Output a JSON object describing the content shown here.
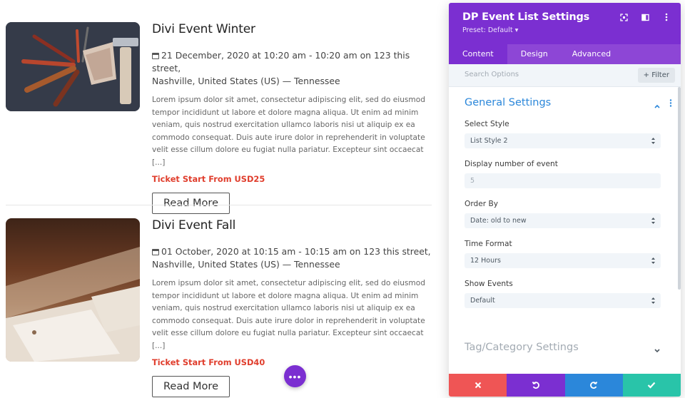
{
  "events": [
    {
      "title": "Divi Event Winter",
      "date_line": "21 December, 2020 at 10:20 am - 10:20 am on 123 this street,",
      "location_line": "Nashville, United States (US) — Tennessee",
      "description": "Lorem ipsum dolor sit amet, consectetur adipiscing elit, sed do eiusmod tempor incididunt ut labore et dolore magna aliqua. Ut enim ad minim veniam, quis nostrud exercitation ullamco laboris nisi ut aliquip ex ea commodo consequat. Duis aute irure dolor in reprehenderit in voluptate velit esse cillum dolore eu fugiat nulla pariatur. Excepteur sint occaecat [...]",
      "price": "Ticket Start From USD25",
      "button": "Read More"
    },
    {
      "title": "Divi Event Fall",
      "date_line": "01 October, 2020 at 10:15 am - 10:15 am on 123 this street,",
      "location_line": "Nashville, United States (US) — Tennessee",
      "description": "Lorem ipsum dolor sit amet, consectetur adipiscing elit, sed do eiusmod tempor incididunt ut labore et dolore magna aliqua. Ut enim ad minim veniam, quis nostrud exercitation ullamco laboris nisi ut aliquip ex ea commodo consequat. Duis aute irure dolor in reprehenderit in voluptate velit esse cillum dolore eu fugiat nulla pariatur. Excepteur sint occaecat [...]",
      "price": "Ticket Start From USD40",
      "button": "Read More"
    }
  ],
  "fab": {
    "label": "•••"
  },
  "panel": {
    "title": "DP Event List Settings",
    "preset": "Preset: Default ▾",
    "tabs": [
      "Content",
      "Design",
      "Advanced"
    ],
    "active_tab": "Content",
    "search_placeholder": "Search Options",
    "filter_label": "+ Filter",
    "section_title": "General Settings",
    "fields": [
      {
        "label": "Select Style",
        "value": "List Style 2"
      },
      {
        "label": "Display number of event",
        "value": "5"
      },
      {
        "label": "Order By",
        "value": "Date: old to new"
      },
      {
        "label": "Time Format",
        "value": "12 Hours"
      },
      {
        "label": "Show Events",
        "value": "Default"
      }
    ],
    "collapsed_section": "Tag/Category Settings",
    "footer_colors": [
      "#ef5555",
      "#7b2fd1",
      "#2b87da",
      "#29c4a9"
    ]
  },
  "colors": {
    "accent": "#7b2fd1",
    "price": "#e03e2d",
    "section": "#2b87da"
  }
}
